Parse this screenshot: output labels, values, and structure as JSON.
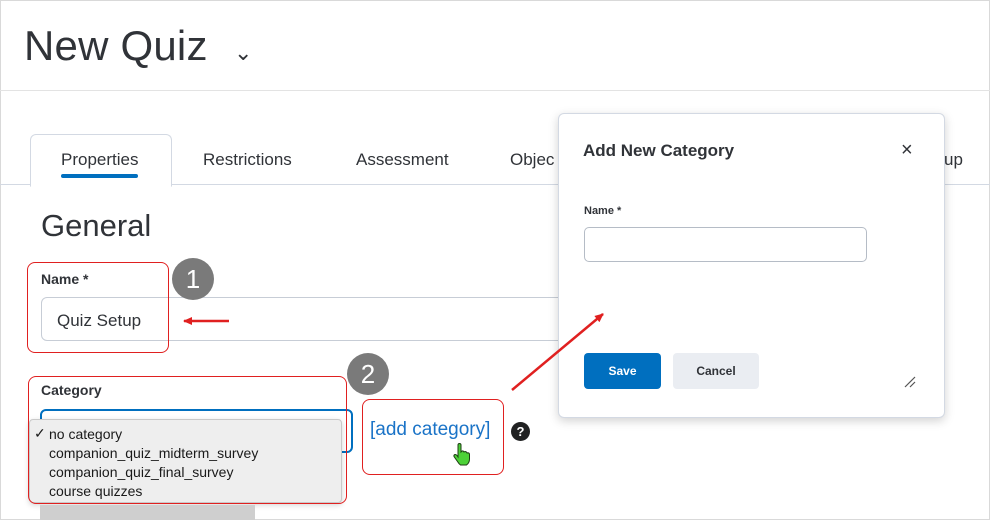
{
  "header": {
    "title": "New Quiz",
    "chevron": "⌄"
  },
  "tabs": [
    {
      "label": "Properties",
      "active": true
    },
    {
      "label": "Restrictions"
    },
    {
      "label": "Assessment"
    },
    {
      "label": "Objec"
    },
    {
      "label": "up"
    }
  ],
  "general": {
    "section_title": "General",
    "name_label": "Name *",
    "name_value": "Quiz Setup",
    "category_label": "Category",
    "category_options": [
      {
        "label": "no category",
        "selected": true
      },
      {
        "label": "companion_quiz_midterm_survey"
      },
      {
        "label": "companion_quiz_final_survey"
      },
      {
        "label": "course quizzes"
      }
    ],
    "add_category_link": "[add category]",
    "help_icon": "?"
  },
  "callouts": {
    "step1": "1",
    "step2": "2",
    "color": "#e02020"
  },
  "dialog": {
    "title": "Add New Category",
    "close_label": "×",
    "name_label": "Name *",
    "name_value": "",
    "save_label": "Save",
    "cancel_label": "Cancel",
    "resize_icon": "resize-grip-icon"
  },
  "colors": {
    "accent": "#006fbf",
    "link": "#1a73c7",
    "annotation": "#e02020",
    "badge": "#7a7a7a"
  }
}
